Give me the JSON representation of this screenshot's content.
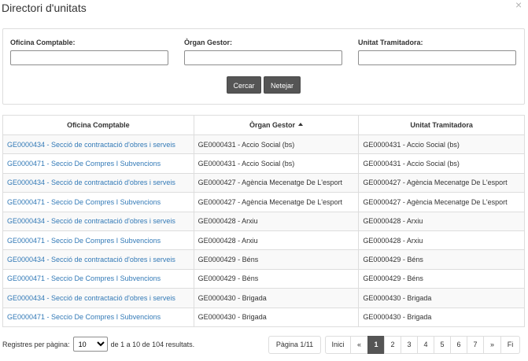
{
  "modal": {
    "title": "Directori d'unitats",
    "close_glyph": "×"
  },
  "filters": {
    "oficina_label": "Oficina Comptable:",
    "oficina_value": "",
    "organ_label": "Òrgan Gestor:",
    "organ_value": "",
    "unitat_label": "Unitat Tramitadora:",
    "unitat_value": "",
    "search_label": "Cercar",
    "clear_label": "Netejar"
  },
  "table": {
    "columns": [
      "Oficina Comptable",
      "Òrgan Gestor",
      "Unitat Tramitadora"
    ],
    "sorted_column_icon": "sort-asc-icon",
    "rows": [
      [
        "GE0000434 - Secció de contractació d'obres i serveis",
        "GE0000431 - Accio Social (bs)",
        "GE0000431 - Accio Social (bs)"
      ],
      [
        "GE0000471 - Seccio De Compres I Subvencions",
        "GE0000431 - Accio Social (bs)",
        "GE0000431 - Accio Social (bs)"
      ],
      [
        "GE0000434 - Secció de contractació d'obres i serveis",
        "GE0000427 - Agència Mecenatge De L'esport",
        "GE0000427 - Agència Mecenatge De L'esport"
      ],
      [
        "GE0000471 - Seccio De Compres I Subvencions",
        "GE0000427 - Agència Mecenatge De L'esport",
        "GE0000427 - Agència Mecenatge De L'esport"
      ],
      [
        "GE0000434 - Secció de contractació d'obres i serveis",
        "GE0000428 - Arxiu",
        "GE0000428 - Arxiu"
      ],
      [
        "GE0000471 - Seccio De Compres I Subvencions",
        "GE0000428 - Arxiu",
        "GE0000428 - Arxiu"
      ],
      [
        "GE0000434 - Secció de contractació d'obres i serveis",
        "GE0000429 - Béns",
        "GE0000429 - Béns"
      ],
      [
        "GE0000471 - Seccio De Compres I Subvencions",
        "GE0000429 - Béns",
        "GE0000429 - Béns"
      ],
      [
        "GE0000434 - Secció de contractació d'obres i serveis",
        "GE0000430 - Brigada",
        "GE0000430 - Brigada"
      ],
      [
        "GE0000471 - Seccio De Compres I Subvencions",
        "GE0000430 - Brigada",
        "GE0000430 - Brigada"
      ]
    ]
  },
  "footer": {
    "per_page_label": "Registres per pàgina:",
    "per_page_value": "10",
    "range_text": "de 1 a 10 de 104 resultats.",
    "page_info": "Pàgina 1/11",
    "pager": {
      "first": "Inici",
      "prev": "«",
      "pages": [
        "1",
        "2",
        "3",
        "4",
        "5",
        "6",
        "7"
      ],
      "active_page": "1",
      "next": "»",
      "last": "Fi"
    }
  },
  "colors": {
    "link": "#337ab7",
    "button": "#555555",
    "border": "#dddddd",
    "stripe": "#f9f9f9"
  }
}
